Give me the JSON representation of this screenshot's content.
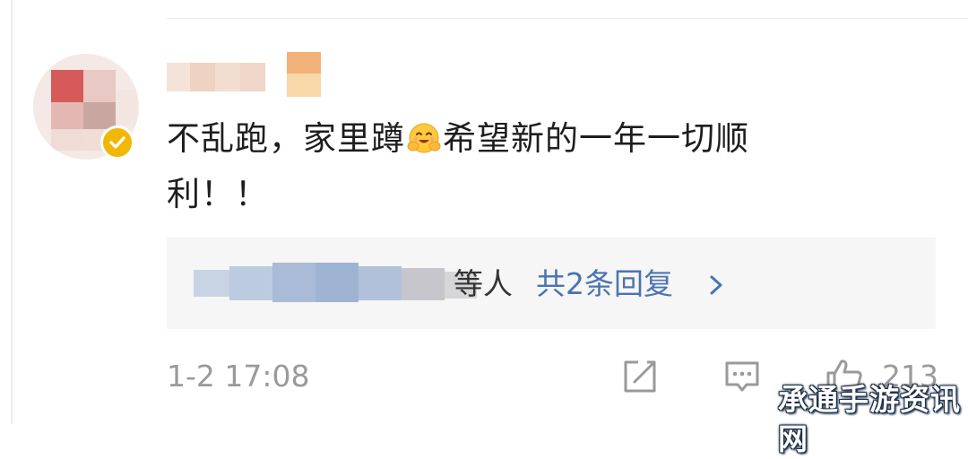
{
  "comment": {
    "text_before_emoji": "不乱跑，家里蹲",
    "emoji": "smiling-face-with-open-hands",
    "text_after_emoji": "希望新的一年一切顺",
    "text_line2": "利！！"
  },
  "reply_preview": {
    "visible_suffix": "等人",
    "count_label": "共2条回复",
    "chevron_icon": "chevron-right-icon"
  },
  "footer": {
    "timestamp": "1-2 17:08",
    "like_count": "213",
    "share_icon": "share-icon",
    "comment_icon": "comment-icon",
    "like_icon": "thumbs-up-icon"
  },
  "colors": {
    "link_blue": "#4a74b0",
    "verified_badge": "#f2b705",
    "muted_gray": "#9a9a9a"
  },
  "watermark": {
    "text": "承通手游资讯网"
  }
}
